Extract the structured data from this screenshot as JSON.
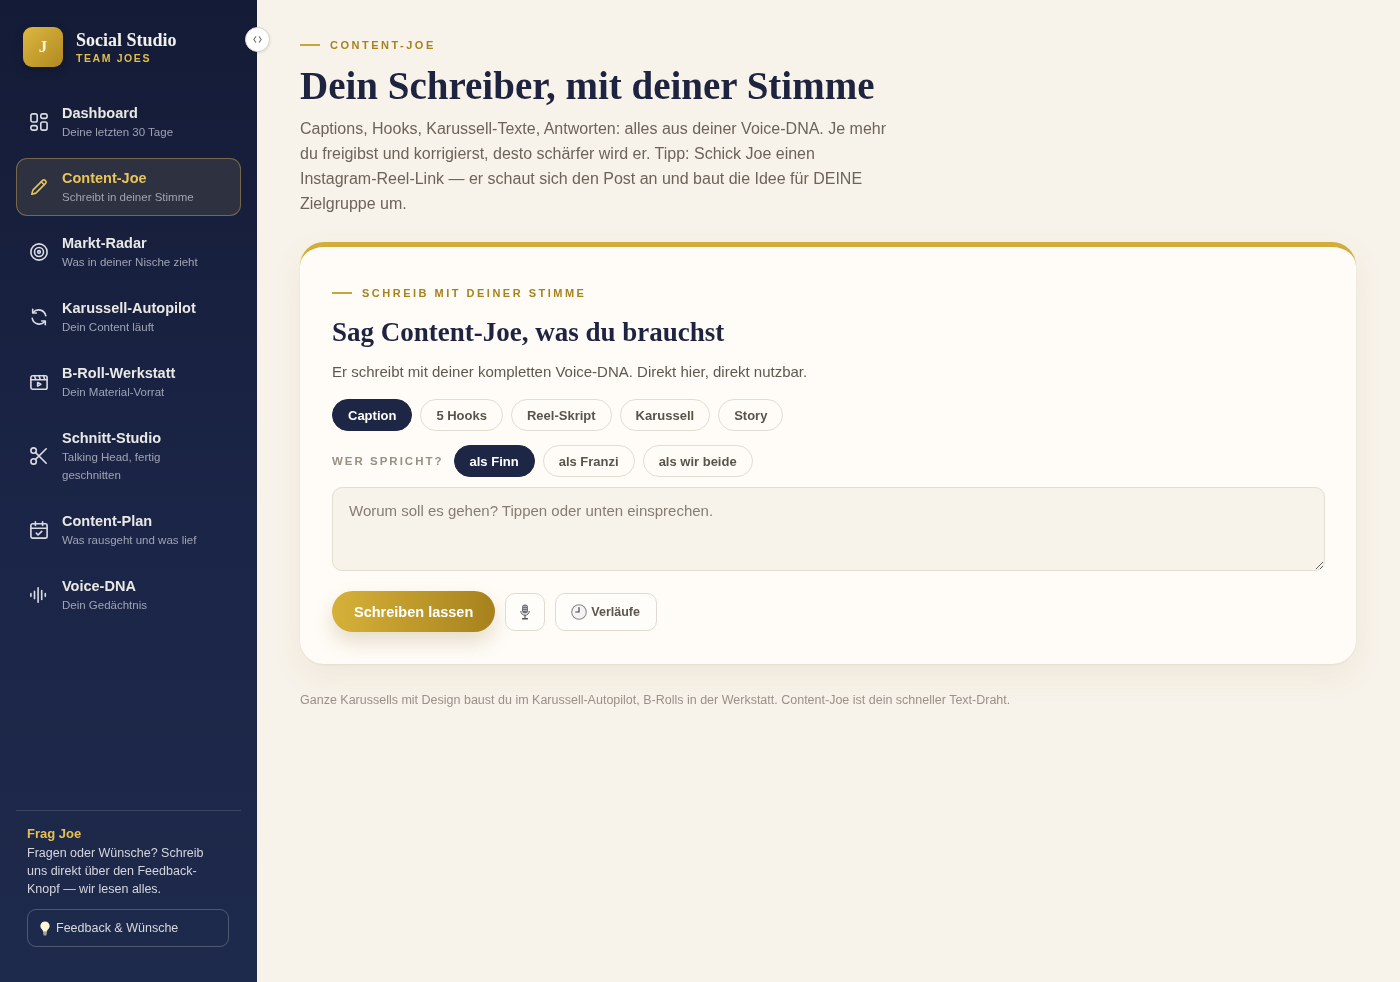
{
  "sidebar": {
    "brand": {
      "logo_letter": "J",
      "name": "Social Studio",
      "team": "TEAM JOES"
    },
    "nav_items": [
      {
        "title": "Dashboard",
        "subtitle": "Deine letzten 30 Tage",
        "selected": false
      },
      {
        "title": "Content-Joe",
        "subtitle": "Schreibt in deiner Stimme",
        "selected": true
      },
      {
        "title": "Markt-Radar",
        "subtitle": "Was in deiner Nische zieht",
        "selected": false
      },
      {
        "title": "Karussell-Autopilot",
        "subtitle": "Dein Content läuft",
        "selected": false
      },
      {
        "title": "B-Roll-Werkstatt",
        "subtitle": "Dein Material-Vorrat",
        "selected": false
      },
      {
        "title": "Schnitt-Studio",
        "subtitle": "Talking Head, fertig geschnitten",
        "selected": false
      },
      {
        "title": "Content-Plan",
        "subtitle": "Was rausgeht und was lief",
        "selected": false
      },
      {
        "title": "Voice-DNA",
        "subtitle": "Dein Gedächtnis",
        "selected": false
      }
    ],
    "help": {
      "title": "Frag Joe",
      "text": "Fragen oder Wünsche? Schreib uns direkt über den Feedback-Knopf — wir lesen alles.",
      "button": "Feedback & Wünsche"
    }
  },
  "main": {
    "eyebrow": "CONTENT-JOE",
    "title": "Dein Schreiber, mit deiner Stimme",
    "intro": "Captions, Hooks, Karussell-Texte, Antworten: alles aus deiner Voice-DNA. Je mehr du freigibst und korrigierst, desto schärfer wird er. Tipp: Schick Joe einen Instagram-Reel-Link — er schaut sich den Post an und baut die Idee für DEINE Zielgruppe um.",
    "composer": {
      "eyebrow": "SCHREIB MIT DEINER STIMME",
      "title": "Sag Content-Joe, was du brauchst",
      "subtitle": "Er schreibt mit deiner kompletten Voice-DNA. Direkt hier, direkt nutzbar.",
      "formats": [
        {
          "label": "Caption",
          "selected": true
        },
        {
          "label": "5 Hooks",
          "selected": false
        },
        {
          "label": "Reel-Skript",
          "selected": false
        },
        {
          "label": "Karussell",
          "selected": false
        },
        {
          "label": "Story",
          "selected": false
        }
      ],
      "speaker_label": "WER SPRICHT?",
      "speakers": [
        {
          "label": "als Finn",
          "selected": true
        },
        {
          "label": "als Franzi",
          "selected": false
        },
        {
          "label": "als wir beide",
          "selected": false
        }
      ],
      "prompt_field": {
        "placeholder": "Worum soll es gehen? Tippen oder unten einsprechen."
      },
      "submit_button": "Schreiben lassen",
      "history_button": "Verläufe"
    },
    "footnote": "Ganze Karussells mit Design baust du im Karussell-Autopilot, B-Rolls in der Werkstatt. Content-Joe ist dein schneller Text-Draht."
  }
}
